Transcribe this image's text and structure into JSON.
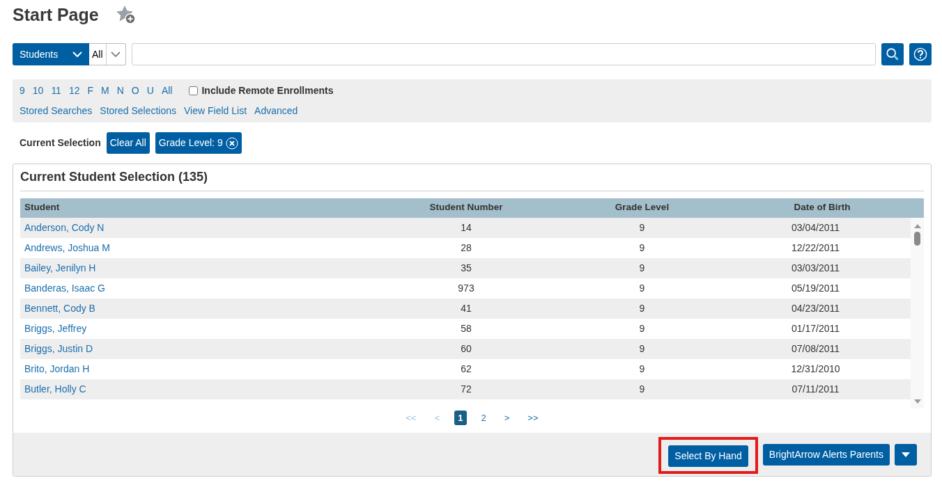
{
  "page": {
    "title": "Start Page"
  },
  "search": {
    "type_select": "Students",
    "scope_select": "All"
  },
  "filters": {
    "quick_links": [
      "9",
      "10",
      "11",
      "12",
      "F",
      "M",
      "N",
      "O",
      "U",
      "All"
    ],
    "include_remote": {
      "label": "Include Remote Enrollments",
      "checked": false
    },
    "links": [
      "Stored Searches",
      "Stored Selections",
      "View Field List",
      "Advanced"
    ]
  },
  "current_selection": {
    "label": "Current Selection",
    "clear_button": "Clear All",
    "chips": [
      {
        "label": "Grade Level: 9"
      }
    ]
  },
  "selection_panel": {
    "title": "Current Student Selection (135)",
    "columns": [
      "Student",
      "Student Number",
      "Grade Level",
      "Date of Birth"
    ],
    "rows": [
      {
        "student": "Anderson, Cody N",
        "number": "14",
        "grade": "9",
        "dob": "03/04/2011"
      },
      {
        "student": "Andrews, Joshua M",
        "number": "28",
        "grade": "9",
        "dob": "12/22/2011"
      },
      {
        "student": "Bailey, Jenilyn H",
        "number": "35",
        "grade": "9",
        "dob": "03/03/2011"
      },
      {
        "student": "Banderas, Isaac G",
        "number": "973",
        "grade": "9",
        "dob": "05/19/2011"
      },
      {
        "student": "Bennett, Cody B",
        "number": "41",
        "grade": "9",
        "dob": "04/23/2011"
      },
      {
        "student": "Briggs, Jeffrey",
        "number": "58",
        "grade": "9",
        "dob": "01/17/2011"
      },
      {
        "student": "Briggs, Justin D",
        "number": "60",
        "grade": "9",
        "dob": "07/08/2011"
      },
      {
        "student": "Brito, Jordan H",
        "number": "62",
        "grade": "9",
        "dob": "12/31/2010"
      },
      {
        "student": "Butler, Holly C",
        "number": "72",
        "grade": "9",
        "dob": "07/11/2011"
      }
    ],
    "pagination": [
      {
        "label": "<<",
        "selected": false,
        "disabled": true
      },
      {
        "label": "<",
        "selected": false,
        "disabled": true
      },
      {
        "label": "1",
        "selected": true,
        "disabled": false
      },
      {
        "label": "2",
        "selected": false,
        "disabled": false
      },
      {
        "label": ">",
        "selected": false,
        "disabled": false
      },
      {
        "label": ">>",
        "selected": false,
        "disabled": false
      }
    ]
  },
  "actions": [
    {
      "label": "Select By Hand",
      "highlighted": true
    },
    {
      "label": "BrightArrow Alerts Parents",
      "highlighted": false
    }
  ]
}
